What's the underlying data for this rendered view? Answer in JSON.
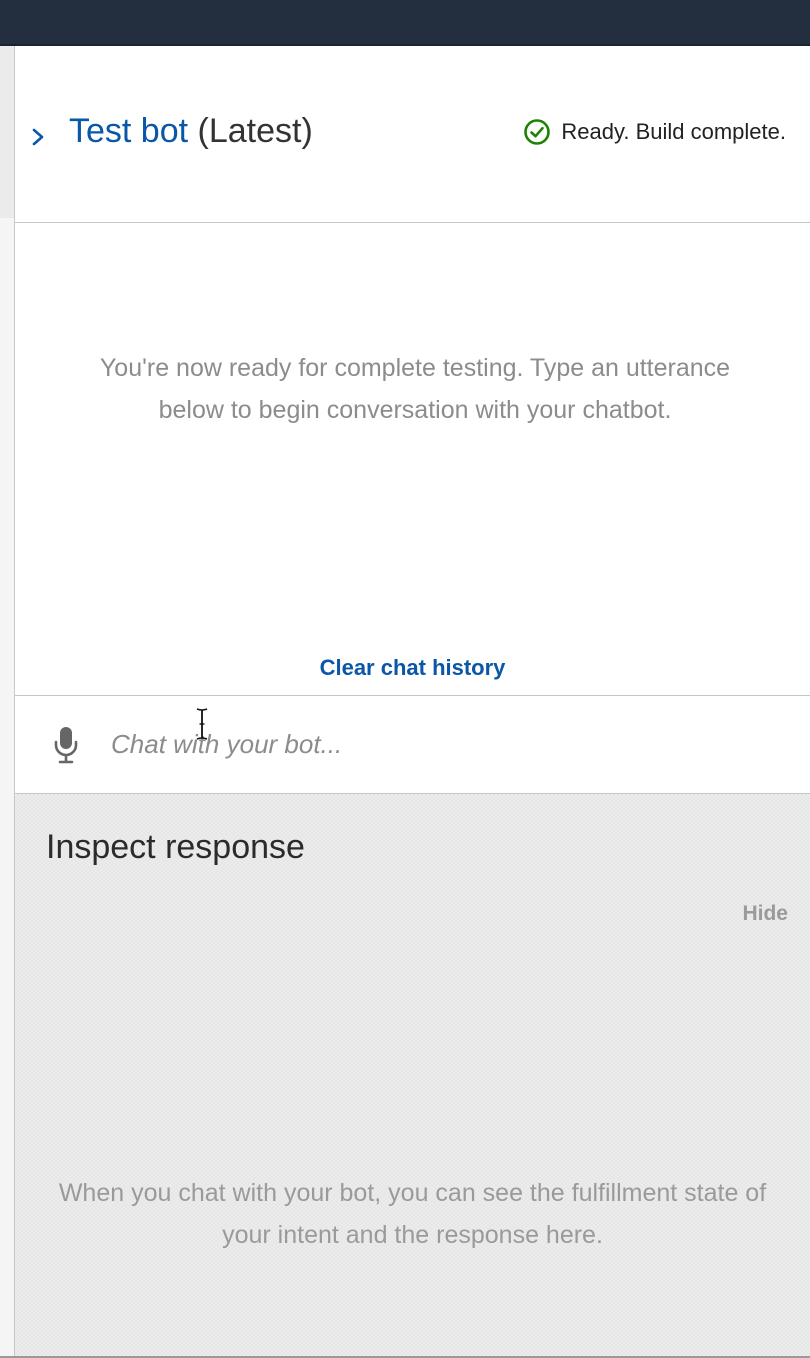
{
  "header": {
    "title_link": "Test bot",
    "title_suffix": "(Latest)",
    "status_text": "Ready. Build complete.",
    "status_color": "#1d8102",
    "expand_icon": "chevron-right-icon",
    "status_icon": "check-circle-icon"
  },
  "chat": {
    "empty_message": "You're now ready for complete testing. Type an utterance below to begin conversation with your chatbot.",
    "clear_label": "Clear chat history",
    "input_placeholder": "Chat with your bot...",
    "input_value": "",
    "mic_icon": "microphone-icon"
  },
  "inspect": {
    "title": "Inspect response",
    "hide_label": "Hide",
    "empty_message": "When you chat with your bot, you can see the fulfillment state of your intent and the response here."
  },
  "colors": {
    "topbar": "#232f3e",
    "link": "#0a57a8",
    "muted_text": "#8c8c8c"
  }
}
